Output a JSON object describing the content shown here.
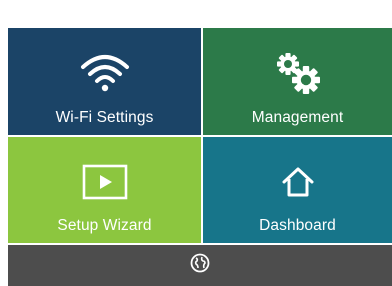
{
  "colors": {
    "wifi_tile": "#1b4467",
    "management_tile": "#2c7a49",
    "setup_tile": "#8cc63f",
    "dashboard_tile": "#17758a",
    "footer_bar": "#4d4d4d",
    "icon": "#ffffff"
  },
  "tiles": {
    "wifi": {
      "label": "Wi-Fi Settings",
      "icon": "wifi-icon"
    },
    "management": {
      "label": "Management",
      "icon": "gears-icon"
    },
    "setup": {
      "label": "Setup Wizard",
      "icon": "play-icon"
    },
    "dashboard": {
      "label": "Dashboard",
      "icon": "home-icon"
    }
  },
  "footer": {
    "icon": "globe-icon"
  }
}
